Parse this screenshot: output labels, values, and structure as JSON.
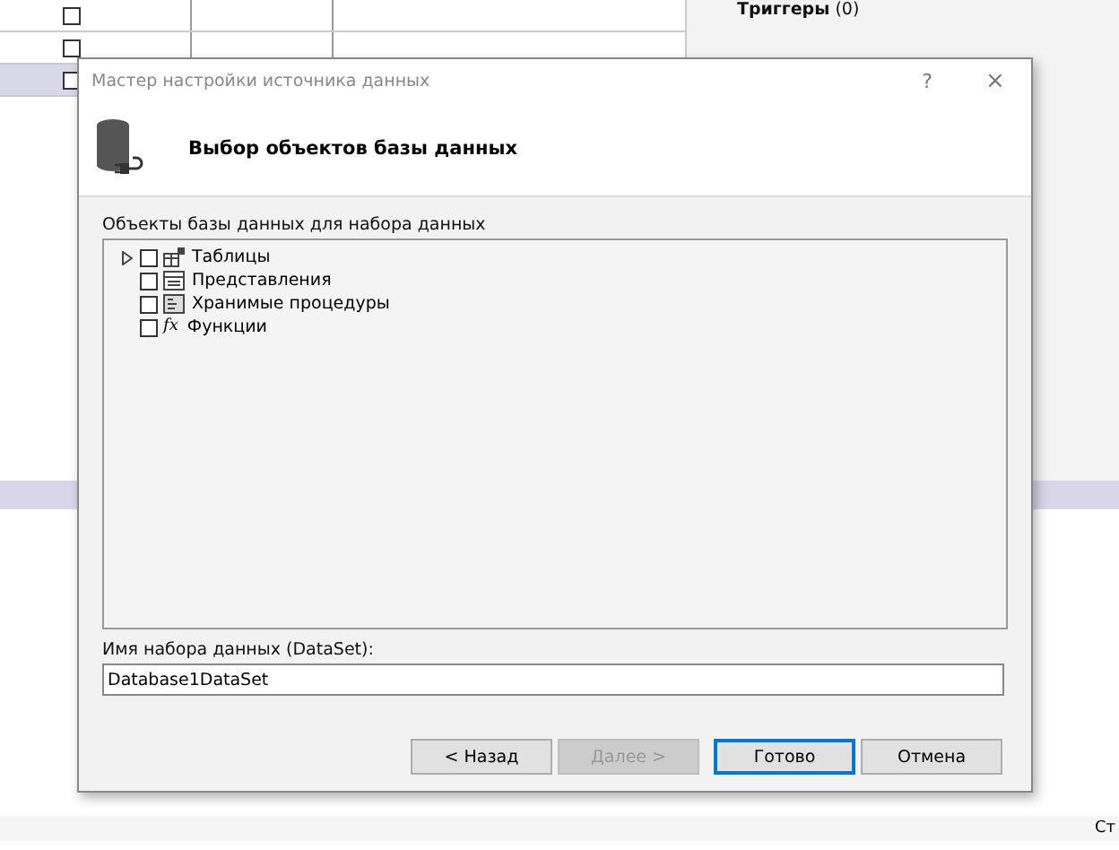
{
  "background": {
    "grid_rows": [
      {
        "checked": false,
        "selected": false
      },
      {
        "checked": false,
        "selected": false
      },
      {
        "checked": false,
        "selected": true
      }
    ],
    "side_panel": {
      "label": "Триггеры",
      "count": "(0)"
    },
    "status_text": "Ст"
  },
  "dialog": {
    "title": "Мастер настройки источника данных",
    "help": "?",
    "close": "×",
    "heading": "Выбор объектов базы данных",
    "tree_label": "Объекты базы данных для набора данных",
    "tree": [
      {
        "label": "Таблицы",
        "kind": "tables",
        "expandable": true,
        "checked": false
      },
      {
        "label": "Представления",
        "kind": "views",
        "expandable": false,
        "checked": false
      },
      {
        "label": "Хранимые процедуры",
        "kind": "procedures",
        "expandable": false,
        "checked": false
      },
      {
        "label": "Функции",
        "kind": "functions",
        "icon": "fx",
        "expandable": false,
        "checked": false
      }
    ],
    "dataset_label": "Имя набора данных (DataSet):",
    "dataset_value": "Database1DataSet",
    "buttons": [
      {
        "label": "< Назад",
        "disabled": false,
        "default": false
      },
      {
        "label": "Далее >",
        "disabled": true,
        "default": false
      },
      {
        "label": "Готово",
        "disabled": false,
        "default": true
      },
      {
        "label": "Отмена",
        "disabled": false,
        "default": false
      }
    ]
  }
}
